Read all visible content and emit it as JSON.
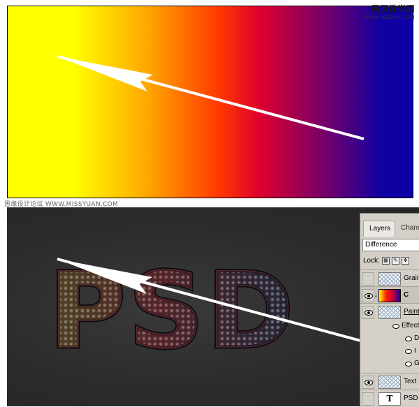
{
  "watermark": {
    "site_cn": "网页教学网",
    "site_url": "WWW.WEB3X.COM",
    "credit": "思缘设计论坛 WWW.MISSYUAN.COM"
  },
  "canvas_text": "PSD",
  "layers_panel": {
    "tabs": [
      "Layers",
      "Chann"
    ],
    "blend_mode": "Difference",
    "lock_label": "Lock:",
    "layers": [
      {
        "name": "Grain",
        "visible": false,
        "type": "pattern"
      },
      {
        "name": "C",
        "visible": true,
        "type": "gradient",
        "clipped": true
      },
      {
        "name": "Paint",
        "visible": true,
        "type": "pattern"
      },
      {
        "name": "Text",
        "visible": true,
        "type": "pattern"
      },
      {
        "name": "PSD",
        "visible": false,
        "type": "text",
        "icon": "T"
      }
    ],
    "effects": {
      "label": "Effect",
      "items": [
        "D",
        "I",
        "G"
      ]
    }
  },
  "colors": {
    "gradient": [
      "#ffff00",
      "#ff3a00",
      "#e0002e",
      "#1200a0"
    ],
    "bottom_bg": "#2d2d2d",
    "panel_bg": "#d4d0c8"
  }
}
